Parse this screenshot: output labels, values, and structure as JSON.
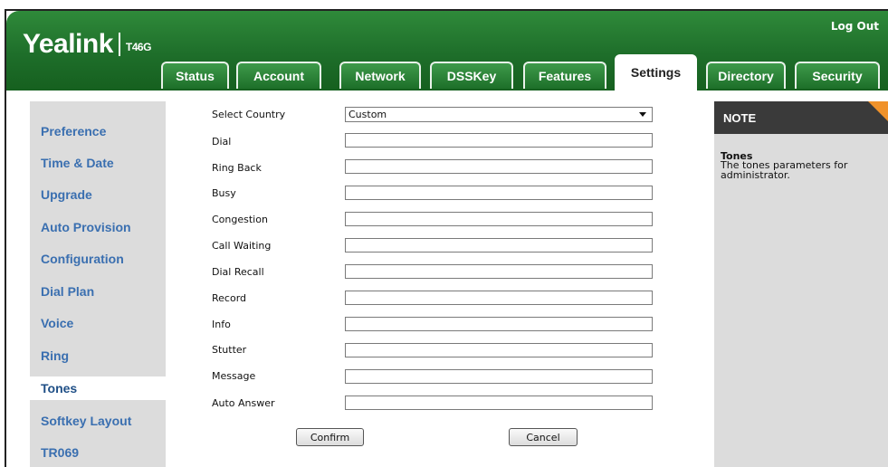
{
  "header": {
    "brand": "Yealink",
    "model": "T46G",
    "logout_label": "Log Out"
  },
  "tabs": [
    {
      "label": "Status"
    },
    {
      "label": "Account"
    },
    {
      "label": "Network"
    },
    {
      "label": "DSSKey"
    },
    {
      "label": "Features"
    },
    {
      "label": "Settings",
      "active": true
    },
    {
      "label": "Directory"
    },
    {
      "label": "Security"
    }
  ],
  "sidebar": {
    "items": [
      {
        "label": "Preference"
      },
      {
        "label": "Time & Date"
      },
      {
        "label": "Upgrade"
      },
      {
        "label": "Auto Provision"
      },
      {
        "label": "Configuration"
      },
      {
        "label": "Dial Plan"
      },
      {
        "label": "Voice"
      },
      {
        "label": "Ring"
      },
      {
        "label": "Tones",
        "active": true
      },
      {
        "label": "Softkey Layout"
      },
      {
        "label": "TR069"
      }
    ]
  },
  "form": {
    "country_label": "Select Country",
    "country_value": "Custom",
    "fields": [
      {
        "label": "Dial",
        "value": ""
      },
      {
        "label": "Ring Back",
        "value": ""
      },
      {
        "label": "Busy",
        "value": ""
      },
      {
        "label": "Congestion",
        "value": ""
      },
      {
        "label": "Call Waiting",
        "value": ""
      },
      {
        "label": "Dial Recall",
        "value": ""
      },
      {
        "label": "Record",
        "value": ""
      },
      {
        "label": "Info",
        "value": ""
      },
      {
        "label": "Stutter",
        "value": ""
      },
      {
        "label": "Message",
        "value": ""
      },
      {
        "label": "Auto Answer",
        "value": ""
      }
    ],
    "confirm_label": "Confirm",
    "cancel_label": "Cancel"
  },
  "note": {
    "title": "NOTE",
    "heading": "Tones",
    "text": "The tones parameters for administrator."
  },
  "colors": {
    "header_green": "#1e6e2a",
    "sidebar_link": "#3a6fb0",
    "note_accent": "#f0922a"
  }
}
